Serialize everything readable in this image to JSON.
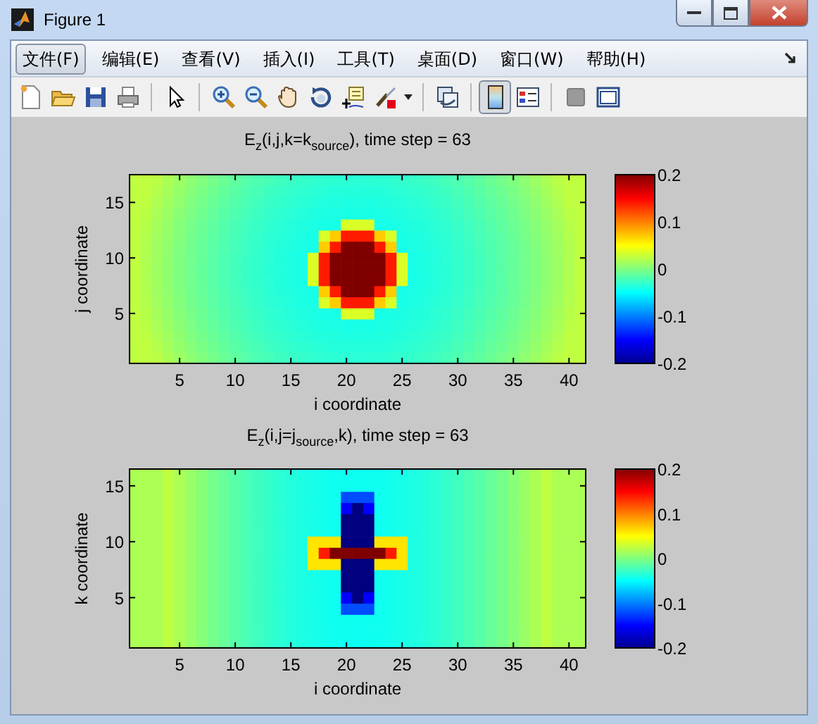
{
  "window": {
    "title": "Figure 1"
  },
  "menu": [
    {
      "label": "文件(F)",
      "selected": true
    },
    {
      "label": "编辑(E)",
      "selected": false
    },
    {
      "label": "查看(V)",
      "selected": false
    },
    {
      "label": "插入(I)",
      "selected": false
    },
    {
      "label": "工具(T)",
      "selected": false
    },
    {
      "label": "桌面(D)",
      "selected": false
    },
    {
      "label": "窗口(W)",
      "selected": false
    },
    {
      "label": "帮助(H)",
      "selected": false
    }
  ],
  "toolbar": [
    [
      {
        "kind": "new",
        "pressed": false
      },
      {
        "kind": "open",
        "pressed": false
      },
      {
        "kind": "save",
        "pressed": false
      },
      {
        "kind": "print",
        "pressed": false
      }
    ],
    [
      {
        "kind": "pointer",
        "pressed": false
      }
    ],
    [
      {
        "kind": "zoom-in",
        "pressed": false
      },
      {
        "kind": "zoom-out",
        "pressed": false
      },
      {
        "kind": "pan",
        "pressed": false
      },
      {
        "kind": "rotate",
        "pressed": false
      },
      {
        "kind": "data-cursor",
        "pressed": false
      },
      {
        "kind": "brush",
        "pressed": false,
        "dropdown": true
      }
    ],
    [
      {
        "kind": "link",
        "pressed": false
      }
    ],
    [
      {
        "kind": "colorbar",
        "pressed": true
      },
      {
        "kind": "legend",
        "pressed": false
      }
    ],
    [
      {
        "kind": "square",
        "pressed": false
      },
      {
        "kind": "frame",
        "pressed": false
      }
    ]
  ],
  "plots": [
    {
      "kind": "source-plane-k",
      "title": "E$_{z}$(i,j,k=k$_{source}$), time step = 63",
      "xlabel": "i coordinate",
      "ylabel": "j coordinate",
      "xticks": [
        "5",
        "10",
        "15",
        "20",
        "25",
        "30",
        "35",
        "40"
      ],
      "yticks": [
        "15",
        "10",
        "5"
      ],
      "colorbar_ticks": [
        "0.2",
        "0.1",
        "0",
        "-0.1",
        "-0.2"
      ]
    },
    {
      "kind": "source-plane-j",
      "title": "E$_{z}$(i,j=j$_{source}$,k), time step = 63",
      "xlabel": "i coordinate",
      "ylabel": "k coordinate",
      "xticks": [
        "5",
        "10",
        "15",
        "20",
        "25",
        "30",
        "35",
        "40"
      ],
      "yticks": [
        "15",
        "10",
        "5"
      ],
      "colorbar_ticks": [
        "0.2",
        "0.1",
        "0",
        "-0.1",
        "-0.2"
      ]
    }
  ]
}
